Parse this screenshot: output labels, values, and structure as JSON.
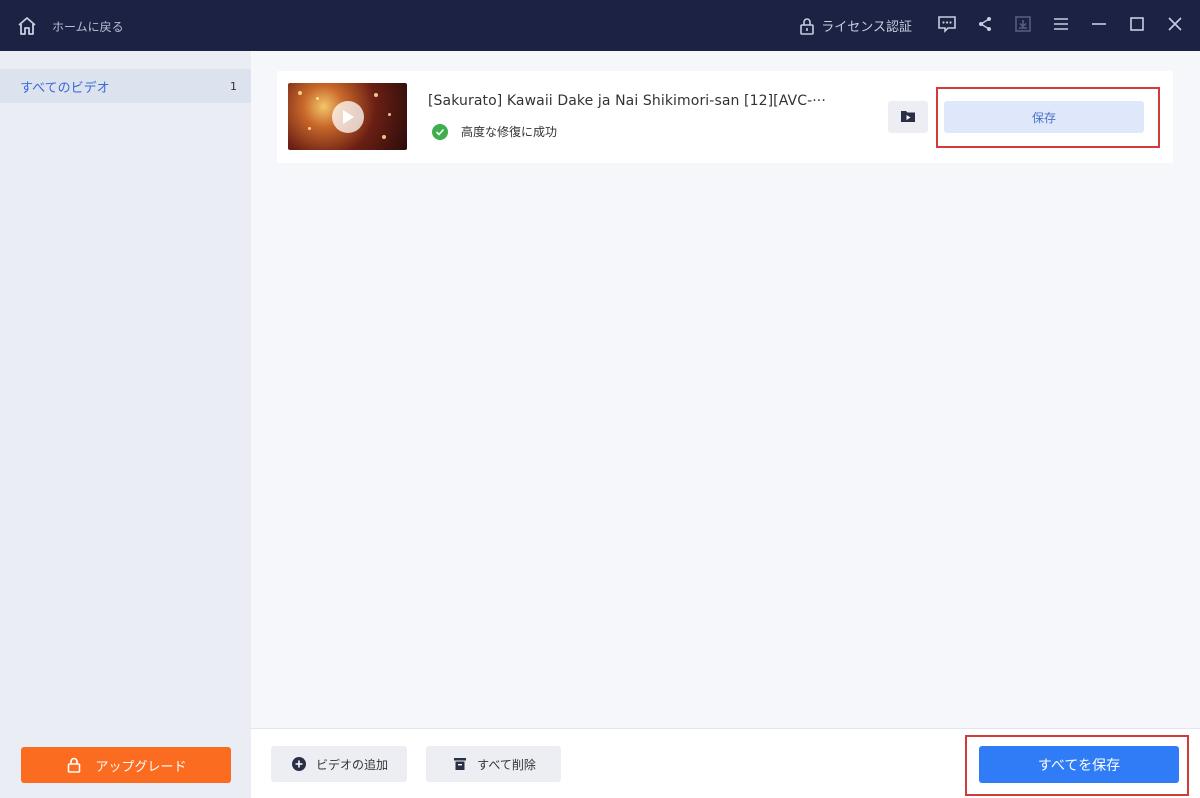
{
  "titlebar": {
    "home_label": "ホームに戻る",
    "license_label": "ライセンス認証",
    "icons": [
      "home-icon",
      "lock-icon",
      "feedback-icon",
      "share-icon",
      "download-icon",
      "menu-icon",
      "minimize-icon",
      "maximize-icon",
      "close-icon"
    ]
  },
  "sidebar": {
    "items": [
      {
        "label": "すべてのビデオ",
        "count": "1"
      }
    ],
    "upgrade_label": "アップグレード"
  },
  "videos": [
    {
      "title": "[Sakurato] Kawaii Dake ja Nai Shikimori-san [12][AVC-···",
      "status": "高度な修復に成功",
      "status_color": "#3fae4f",
      "save_label": "保存"
    }
  ],
  "bottombar": {
    "add_video_label": "ビデオの追加",
    "delete_all_label": "すべて削除",
    "save_all_label": "すべてを保存"
  },
  "colors": {
    "titlebar_bg": "#1c2244",
    "accent": "#2f7cf6",
    "upgrade": "#fb6c20",
    "highlight": "#d33a3a"
  }
}
